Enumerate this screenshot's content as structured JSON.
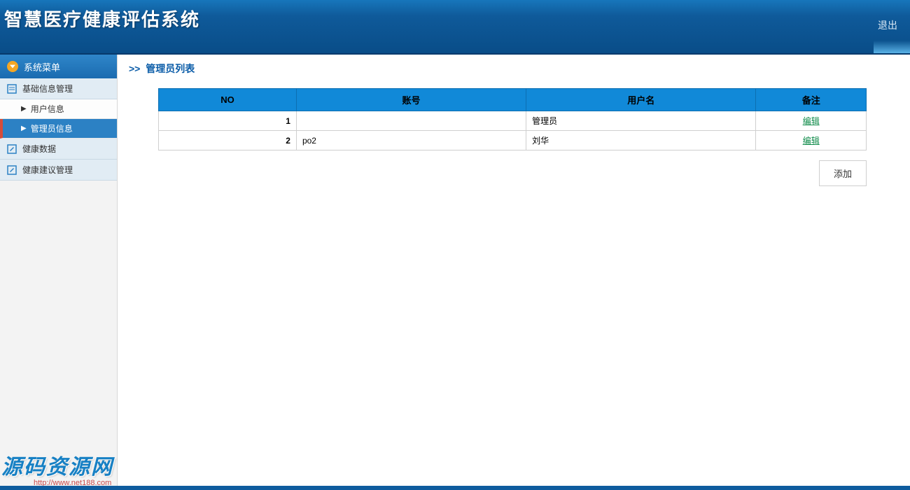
{
  "header": {
    "title": "智慧医疗健康评估系统",
    "logout": "退出"
  },
  "sidebar": {
    "menu_title": "系统菜单",
    "sections": [
      {
        "label": "基础信息管理",
        "subs": [
          {
            "label": "用户信息",
            "active": false
          },
          {
            "label": "管理员信息",
            "active": true
          }
        ]
      },
      {
        "label": "健康数据",
        "subs": []
      },
      {
        "label": "健康建议管理",
        "subs": []
      }
    ]
  },
  "page": {
    "crumb_prefix": ">>",
    "crumb": "管理员列表",
    "columns": {
      "no": "NO",
      "account": "账号",
      "username": "用户名",
      "remark": "备注"
    },
    "rows": [
      {
        "no": "1",
        "account": "",
        "username": "管理员",
        "action": "编辑"
      },
      {
        "no": "2",
        "account": "po2",
        "username": "刘华",
        "action": "编辑"
      }
    ],
    "add_button": "添加"
  },
  "watermark": {
    "title": "源码资源网",
    "url": "http://www.net188.com"
  }
}
